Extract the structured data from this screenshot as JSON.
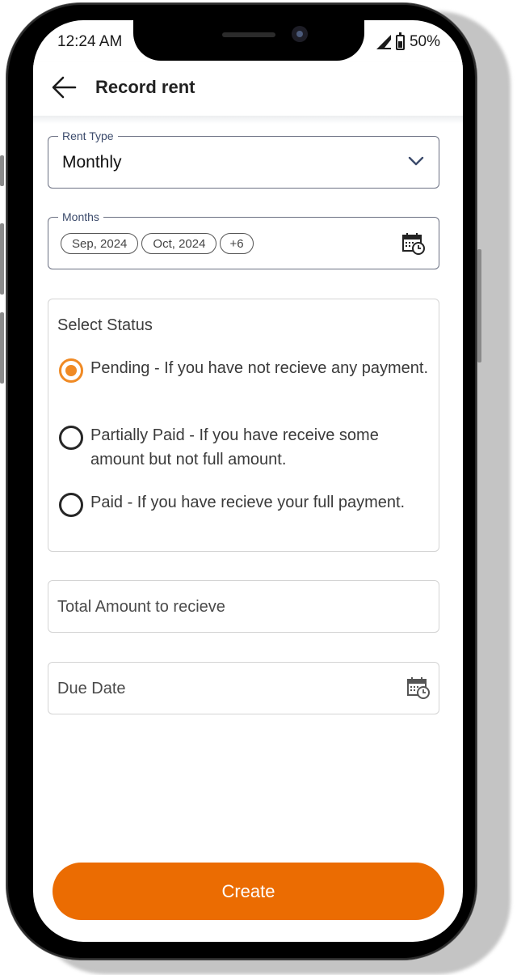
{
  "status_bar": {
    "time": "12:24 AM",
    "battery": "50%"
  },
  "appbar": {
    "title": "Record rent",
    "back_icon": "arrow-left-icon"
  },
  "form": {
    "rent_type": {
      "label": "Rent Type",
      "value": "Monthly",
      "icon": "chevron-down-icon"
    },
    "months": {
      "label": "Months",
      "chips": [
        "Sep, 2024",
        "Oct, 2024",
        "+6"
      ],
      "icon": "calendar-clock-icon"
    },
    "status": {
      "title": "Select Status",
      "selected": "pending",
      "options": [
        {
          "id": "pending",
          "label": "Pending - If you have not recieve any payment."
        },
        {
          "id": "partially_paid",
          "label": "Partially Paid - If you have receive some amount but not full amount."
        },
        {
          "id": "paid",
          "label": "Paid - If you have recieve your full payment."
        }
      ]
    },
    "total_amount": {
      "placeholder": "Total Amount to recieve",
      "value": ""
    },
    "due_date": {
      "placeholder": "Due Date",
      "value": "",
      "icon": "calendar-clock-icon"
    }
  },
  "actions": {
    "create_label": "Create"
  },
  "colors": {
    "accent": "#eb6c02",
    "radio_selected": "#f08a24",
    "legend_text": "#3b4a6b"
  }
}
